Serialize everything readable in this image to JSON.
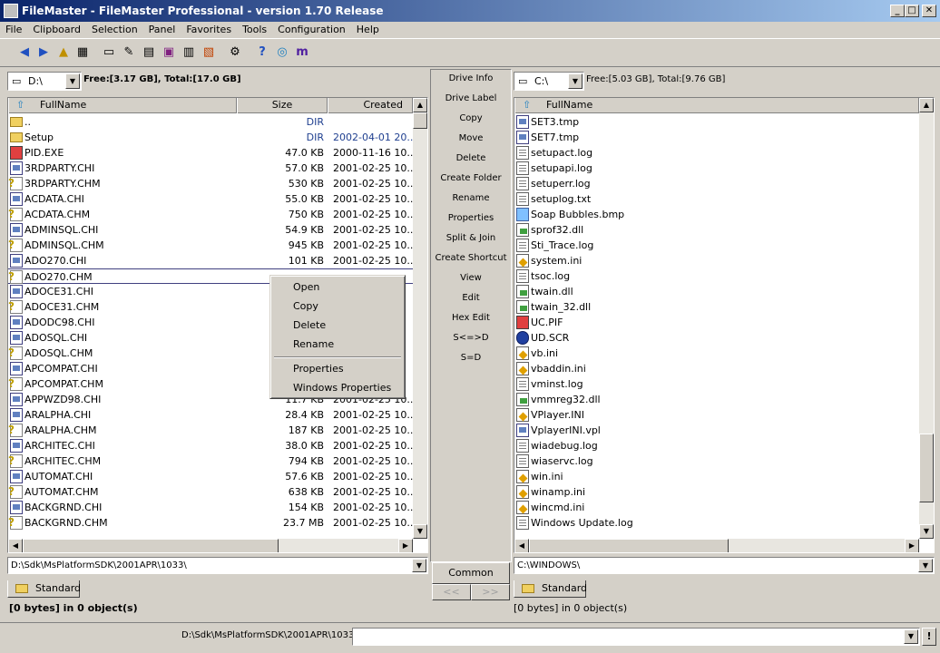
{
  "window": {
    "title": "FileMaster - FileMaster Professional - version 1.70 Release",
    "min": "_",
    "max": "□",
    "close": "✕"
  },
  "menu": [
    "File",
    "Clipboard",
    "Selection",
    "Panel",
    "Favorites",
    "Tools",
    "Configuration",
    "Help"
  ],
  "left_panel": {
    "drive": "D:\\",
    "free": "Free:[3.17 GB], Total:[17.0 GB]",
    "columns": [
      "FullName",
      "Size",
      "Created"
    ],
    "rows": [
      {
        "name": "..",
        "size": "DIR",
        "created": "",
        "icon": "folder"
      },
      {
        "name": "Setup",
        "size": "DIR",
        "created": "2002-04-01 20...",
        "icon": "folder"
      },
      {
        "name": "PID.EXE",
        "size": "47.0 KB",
        "created": "2000-11-16 10...",
        "icon": "exe"
      },
      {
        "name": "3RDPARTY.CHI",
        "size": "57.0 KB",
        "created": "2001-02-25 10...",
        "icon": "chi"
      },
      {
        "name": "3RDPARTY.CHM",
        "size": "530 KB",
        "created": "2001-02-25 10...",
        "icon": "chm"
      },
      {
        "name": "ACDATA.CHI",
        "size": "55.0 KB",
        "created": "2001-02-25 10...",
        "icon": "chi"
      },
      {
        "name": "ACDATA.CHM",
        "size": "750 KB",
        "created": "2001-02-25 10...",
        "icon": "chm"
      },
      {
        "name": "ADMINSQL.CHI",
        "size": "54.9 KB",
        "created": "2001-02-25 10...",
        "icon": "chi"
      },
      {
        "name": "ADMINSQL.CHM",
        "size": "945 KB",
        "created": "2001-02-25 10...",
        "icon": "chm"
      },
      {
        "name": "ADO270.CHI",
        "size": "101 KB",
        "created": "2001-02-25 10...",
        "icon": "chi"
      },
      {
        "name": "ADO270.CHM",
        "size": "",
        "created": "",
        "icon": "chm"
      },
      {
        "name": "ADOCE31.CHI",
        "size": "",
        "created": "",
        "icon": "chi"
      },
      {
        "name": "ADOCE31.CHM",
        "size": "",
        "created": "",
        "icon": "chm"
      },
      {
        "name": "ADODC98.CHI",
        "size": "",
        "created": "",
        "icon": "chi"
      },
      {
        "name": "ADOSQL.CHI",
        "size": "",
        "created": "",
        "icon": "chi"
      },
      {
        "name": "ADOSQL.CHM",
        "size": "",
        "created": "",
        "icon": "chm"
      },
      {
        "name": "APCOMPAT.CHI",
        "size": "",
        "created": "",
        "icon": "chi"
      },
      {
        "name": "APCOMPAT.CHM",
        "size": "",
        "created": "",
        "icon": "chm"
      },
      {
        "name": "APPWZD98.CHI",
        "size": "11.7 KB",
        "created": "2001-02-25 10...",
        "icon": "chi"
      },
      {
        "name": "ARALPHA.CHI",
        "size": "28.4 KB",
        "created": "2001-02-25 10...",
        "icon": "chi"
      },
      {
        "name": "ARALPHA.CHM",
        "size": "187 KB",
        "created": "2001-02-25 10...",
        "icon": "chm"
      },
      {
        "name": "ARCHITEC.CHI",
        "size": "38.0 KB",
        "created": "2001-02-25 10...",
        "icon": "chi"
      },
      {
        "name": "ARCHITEC.CHM",
        "size": "794 KB",
        "created": "2001-02-25 10...",
        "icon": "chm"
      },
      {
        "name": "AUTOMAT.CHI",
        "size": "57.6 KB",
        "created": "2001-02-25 10...",
        "icon": "chi"
      },
      {
        "name": "AUTOMAT.CHM",
        "size": "638 KB",
        "created": "2001-02-25 10...",
        "icon": "chm"
      },
      {
        "name": "BACKGRND.CHI",
        "size": "154 KB",
        "created": "2001-02-25 10...",
        "icon": "chi"
      },
      {
        "name": "BACKGRND.CHM",
        "size": "23.7 MB",
        "created": "2001-02-25 10...",
        "icon": "chm"
      }
    ],
    "path": "D:\\Sdk\\MsPlatformSDK\\2001APR\\1033\\",
    "tab": "Standard",
    "status": "[0 bytes] in 0 object(s)"
  },
  "commands": [
    "Drive Info",
    "Drive Label",
    "Copy",
    "Move",
    "Delete",
    "Create Folder",
    "Rename",
    "Properties",
    "Split & Join",
    "Create Shortcut",
    "View",
    "Edit",
    "Hex Edit",
    "S<=>D",
    "S=D"
  ],
  "common": {
    "label": "Common",
    "prev": "<<",
    "next": ">>"
  },
  "right_panel": {
    "drive": "C:\\",
    "free": "Free:[5.03 GB], Total:[9.76 GB]",
    "columns": [
      "FullName"
    ],
    "rows": [
      {
        "name": "SET3.tmp",
        "icon": "chi"
      },
      {
        "name": "SET7.tmp",
        "icon": "chi"
      },
      {
        "name": "setupact.log",
        "icon": "doc"
      },
      {
        "name": "setupapi.log",
        "icon": "doc"
      },
      {
        "name": "setuperr.log",
        "icon": "doc"
      },
      {
        "name": "setuplog.txt",
        "icon": "doc"
      },
      {
        "name": "Soap Bubbles.bmp",
        "icon": "bmp"
      },
      {
        "name": "sprof32.dll",
        "icon": "dll"
      },
      {
        "name": "Sti_Trace.log",
        "icon": "doc"
      },
      {
        "name": "system.ini",
        "icon": "ini"
      },
      {
        "name": "tsoc.log",
        "icon": "doc"
      },
      {
        "name": "twain.dll",
        "icon": "dll"
      },
      {
        "name": "twain_32.dll",
        "icon": "dll"
      },
      {
        "name": "UC.PIF",
        "icon": "exe"
      },
      {
        "name": "UD.SCR",
        "icon": "scr"
      },
      {
        "name": "vb.ini",
        "icon": "ini"
      },
      {
        "name": "vbaddin.ini",
        "icon": "ini"
      },
      {
        "name": "vminst.log",
        "icon": "doc"
      },
      {
        "name": "vmmreg32.dll",
        "icon": "dll"
      },
      {
        "name": "VPlayer.INI",
        "icon": "ini"
      },
      {
        "name": "VplayerINI.vpl",
        "icon": "chi"
      },
      {
        "name": "wiadebug.log",
        "icon": "doc"
      },
      {
        "name": "wiaservc.log",
        "icon": "doc"
      },
      {
        "name": "win.ini",
        "icon": "ini"
      },
      {
        "name": "winamp.ini",
        "icon": "ini"
      },
      {
        "name": "wincmd.ini",
        "icon": "ini"
      },
      {
        "name": "Windows Update.log",
        "icon": "doc"
      }
    ],
    "path": "C:\\WINDOWS\\",
    "tab": "Standard",
    "status": "[0 bytes] in 0 object(s)"
  },
  "context_menu": {
    "items": [
      "Open",
      "Copy",
      "Delete",
      "Rename"
    ],
    "items2": [
      "Properties",
      "Windows Properties"
    ]
  },
  "bottom": {
    "path": "D:\\Sdk\\MsPlatformSDK\\2001APR\\1033\\",
    "go": "!"
  }
}
